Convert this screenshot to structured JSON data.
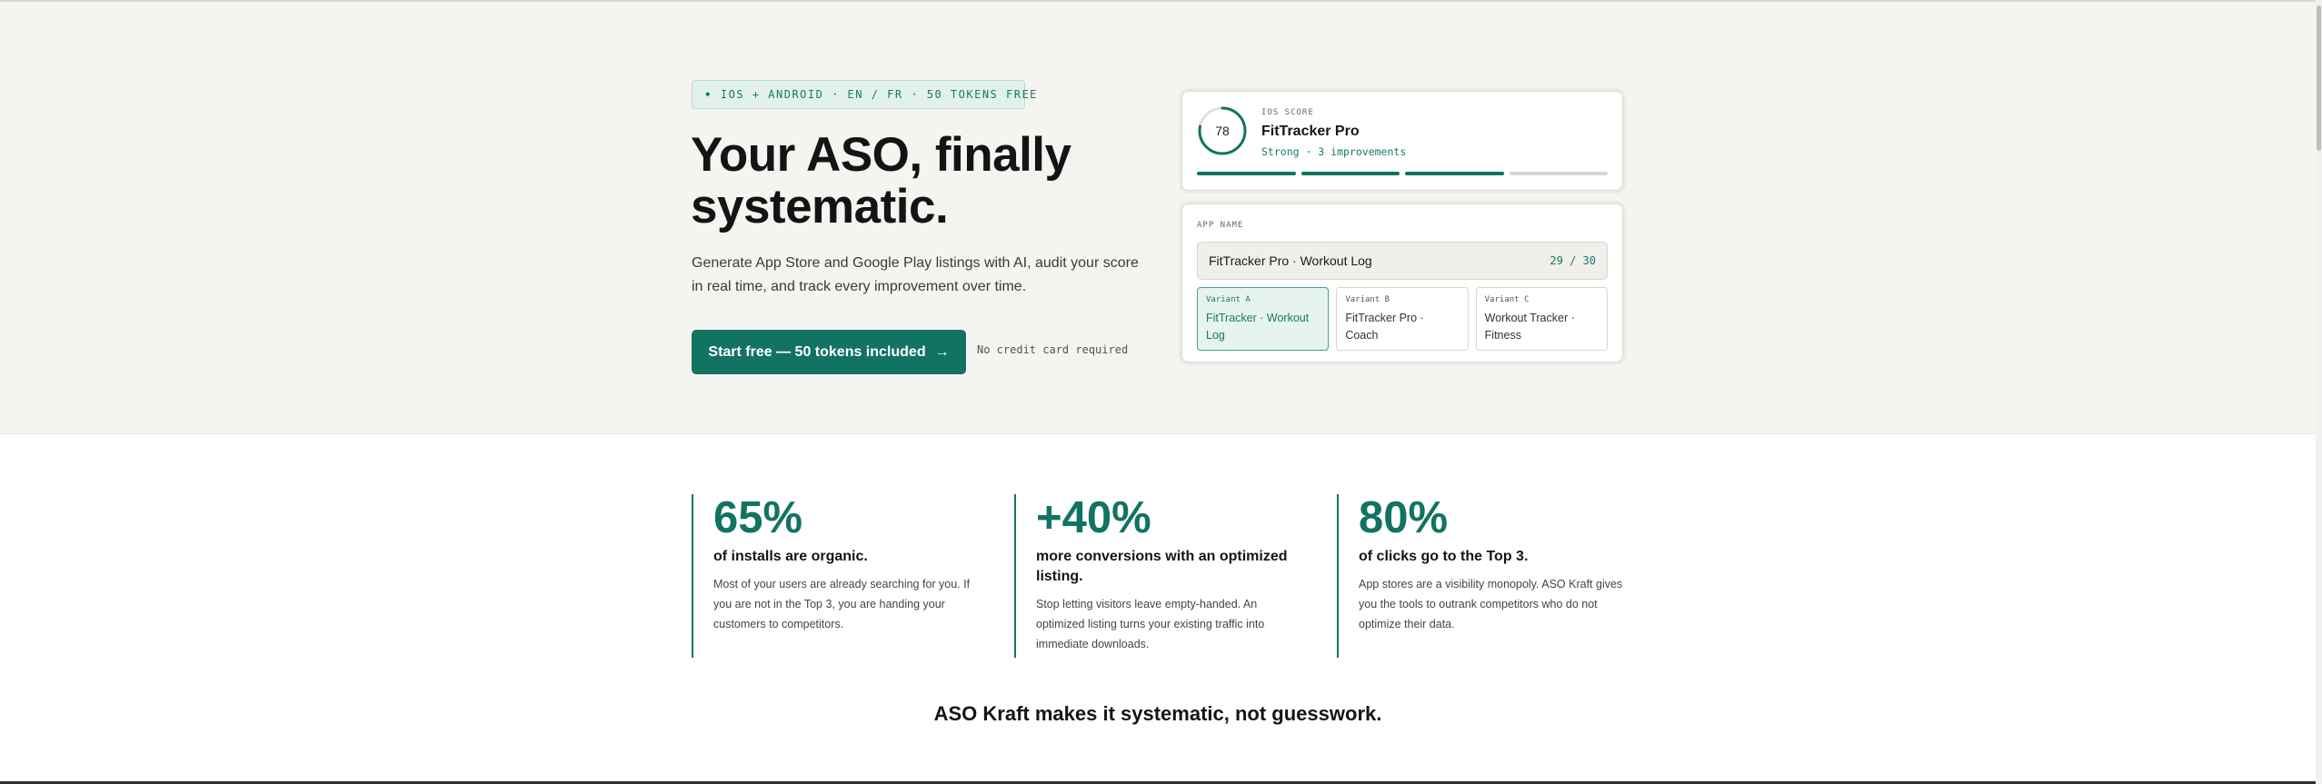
{
  "hero": {
    "badge": "IOS + ANDROID · EN / FR · 50 TOKENS FREE",
    "badge_icon": "diamond-icon",
    "title_line1": "Your ASO, finally",
    "title_line2": "systematic.",
    "subtitle": "Generate App Store and Google Play listings with AI, audit your score in real time, and track every improvement over time.",
    "cta_label": "Start free — 50 tokens included",
    "cta_icon": "arrow-right-icon",
    "no_credit_card": "No credit card required"
  },
  "score_card": {
    "score": "78",
    "score_fraction": 0.78,
    "label": "IOS SCORE",
    "app_name": "FitTracker Pro",
    "status": "Strong · 3 improvements",
    "segments_total": 4,
    "segments_filled": 3,
    "accent": "#137362"
  },
  "name_card": {
    "label": "APP NAME",
    "input_value": "FitTracker Pro · Workout Log",
    "char_count": "29 / 30",
    "variants": [
      {
        "label": "Variant A",
        "text": "FitTracker · Workout Log",
        "selected": true
      },
      {
        "label": "Variant B",
        "text": "FitTracker Pro · Coach",
        "selected": false
      },
      {
        "label": "Variant C",
        "text": "Workout Tracker · Fitness",
        "selected": false
      }
    ]
  },
  "stats": [
    {
      "value": "65%",
      "heading": "of installs are organic.",
      "body": "Most of your users are already searching for you. If you are not in the Top 3, you are handing your customers to competitors."
    },
    {
      "value": "+40%",
      "heading": "more conversions with an optimized listing.",
      "body": "Stop letting visitors leave empty-handed. An optimized listing turns your existing traffic into immediate downloads."
    },
    {
      "value": "80%",
      "heading": "of clicks go to the Top 3.",
      "body": "App stores are a visibility monopoly. ASO Kraft gives you the tools to outrank competitors who do not optimize their data."
    }
  ],
  "tagline": "ASO Kraft makes it systematic, not guesswork.",
  "colors": {
    "brand": "#137362",
    "hero_bg": "#f5f4f0"
  }
}
